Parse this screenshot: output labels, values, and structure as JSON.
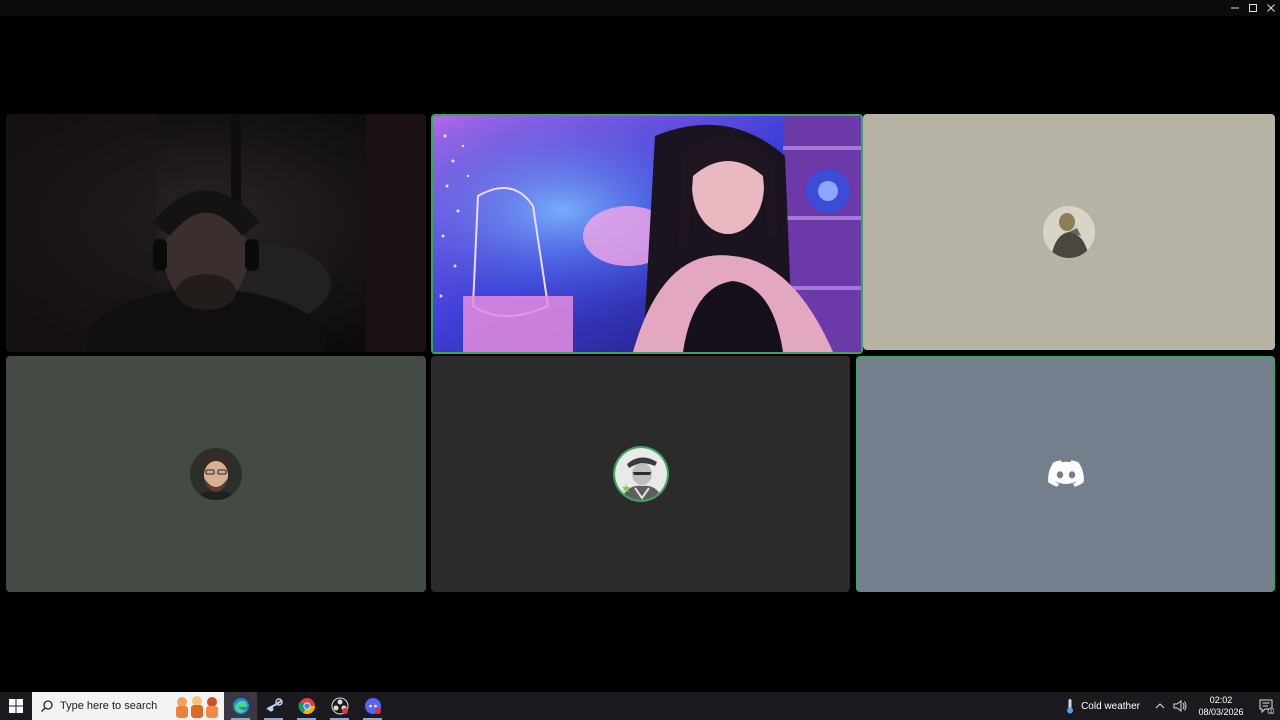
{
  "window": {
    "controls": [
      "minimize",
      "maximize",
      "close"
    ]
  },
  "call": {
    "participants": [
      {
        "id": "p1",
        "kind": "video",
        "scene": "dark-room-headset",
        "speaking": false
      },
      {
        "id": "p2",
        "kind": "video",
        "scene": "neon-galaxy-room",
        "speaking": true
      },
      {
        "id": "p3",
        "kind": "avatar",
        "avatar_icon": "statue-avatar-icon",
        "background": "#b7b3a4",
        "speaking": false
      },
      {
        "id": "p4",
        "kind": "avatar",
        "avatar_icon": "bearded-man-avatar-icon",
        "background": "#444b45",
        "speaking": false
      },
      {
        "id": "p5",
        "kind": "avatar",
        "avatar_icon": "officer-avatar-icon",
        "background": "#2b2b2b",
        "speaking": true
      },
      {
        "id": "p6",
        "kind": "avatar",
        "avatar_icon": "discord-logo-icon",
        "background": "#747f8d",
        "speaking": true
      }
    ]
  },
  "taskbar": {
    "search_placeholder": "Type here to search",
    "apps": [
      "edge-icon",
      "steam-icon",
      "chrome-icon",
      "obs-icon",
      "discord-icon"
    ],
    "weather": "Cold weather",
    "time": "02:02",
    "date": "08/03/2026",
    "notification_count": "1"
  },
  "colors": {
    "accent_speaking": "#3ba55c",
    "discord_blurple_gray": "#747f8d",
    "taskbar_bg": "#1c1a1f"
  }
}
